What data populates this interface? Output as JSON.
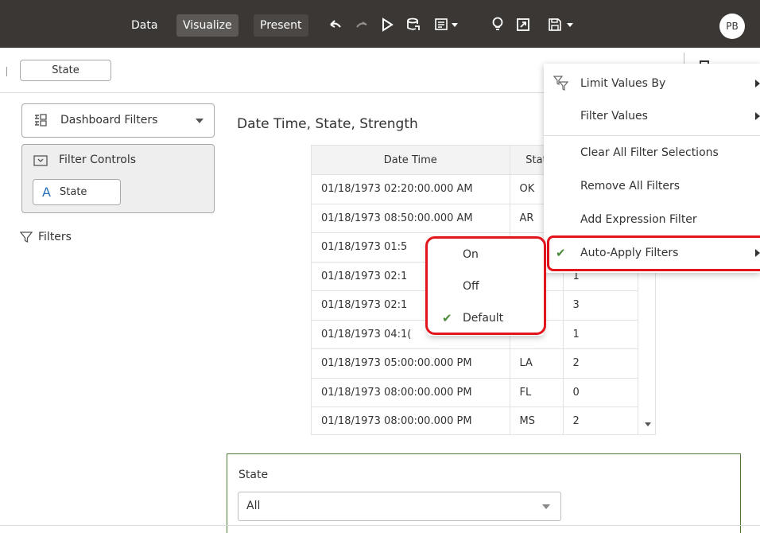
{
  "topbar": {
    "tabs": [
      "Data",
      "Visualize",
      "Present"
    ],
    "avatar": "PB"
  },
  "state_pill": "State",
  "sidebar": {
    "dashboard_filters": "Dashboard Filters",
    "filter_controls": "Filter Controls",
    "state_control": "State",
    "filters": "Filters"
  },
  "viz": {
    "title": "Date Time, State, Strength",
    "headers": [
      "Date Time",
      "Stat",
      ""
    ],
    "rows": [
      [
        "01/18/1973 02:20:00.000 AM",
        "OK",
        ""
      ],
      [
        "01/18/1973 08:50:00.000 AM",
        "AR",
        ""
      ],
      [
        "01/18/1973 01:5",
        "",
        ""
      ],
      [
        "01/18/1973 02:1",
        "",
        "1"
      ],
      [
        "01/18/1973 02:1",
        "",
        "3"
      ],
      [
        "01/18/1973 04:1(",
        "",
        "1"
      ],
      [
        "01/18/1973 05:00:00.000 PM",
        "LA",
        "2"
      ],
      [
        "01/18/1973 08:00:00.000 PM",
        "FL",
        "0"
      ],
      [
        "01/18/1973 08:00:00.000 PM",
        "MS",
        "2"
      ]
    ]
  },
  "context_menu": {
    "items": [
      "Limit Values By",
      "Filter Values",
      "Clear All Filter Selections",
      "Remove All Filters",
      "Add Expression Filter",
      "Auto-Apply Filters"
    ]
  },
  "submenu": {
    "items": [
      "On",
      "Off",
      "Default"
    ]
  },
  "state_filter": {
    "label": "State",
    "value": "All"
  },
  "colors": {
    "topbar": "#3a3734",
    "highlight": "#e2141c",
    "check": "#4a8a3a",
    "panel_border": "#4d7c3a"
  }
}
